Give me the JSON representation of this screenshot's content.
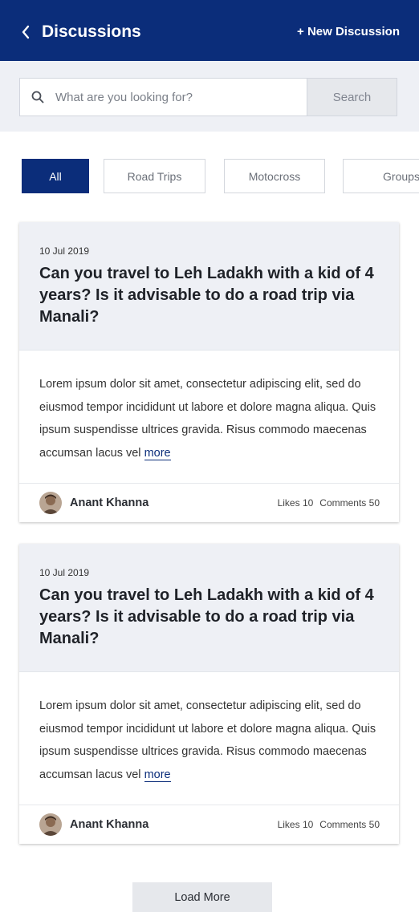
{
  "header": {
    "title": "Discussions",
    "new_discussion_label": "+ New Discussion",
    "background": "#0b2d7a"
  },
  "search": {
    "placeholder": "What are you looking for?",
    "button_label": "Search"
  },
  "filters": [
    {
      "label": "All",
      "active": true
    },
    {
      "label": "Road Trips",
      "active": false
    },
    {
      "label": "Motocross",
      "active": false
    },
    {
      "label": "Groups",
      "active": false
    }
  ],
  "posts": [
    {
      "date": "10 Jul 2019",
      "title": "Can you travel to Leh Ladakh with a kid of 4 years? Is it advisable to do a road trip via Manali?",
      "excerpt": "Lorem ipsum dolor sit amet, consectetur adipiscing elit, sed do eiusmod tempor incididunt ut labore et dolore magna aliqua. Quis ipsum suspendisse ultrices gravida. Risus commodo maecenas accumsan lacus vel",
      "more_label": "more",
      "author": "Anant Khanna",
      "likes": "Likes 10",
      "comments": "Comments 50"
    },
    {
      "date": "10 Jul 2019",
      "title": "Can you travel to Leh Ladakh with a kid of 4 years? Is it advisable to do a road trip via Manali?",
      "excerpt": "Lorem ipsum dolor sit amet, consectetur adipiscing elit, sed do eiusmod tempor incididunt ut labore et dolore magna aliqua. Quis ipsum suspendisse ultrices gravida. Risus commodo maecenas accumsan lacus vel",
      "more_label": "more",
      "author": "Anant Khanna",
      "likes": "Likes 10",
      "comments": "Comments 50"
    }
  ],
  "load_more_label": "Load More"
}
